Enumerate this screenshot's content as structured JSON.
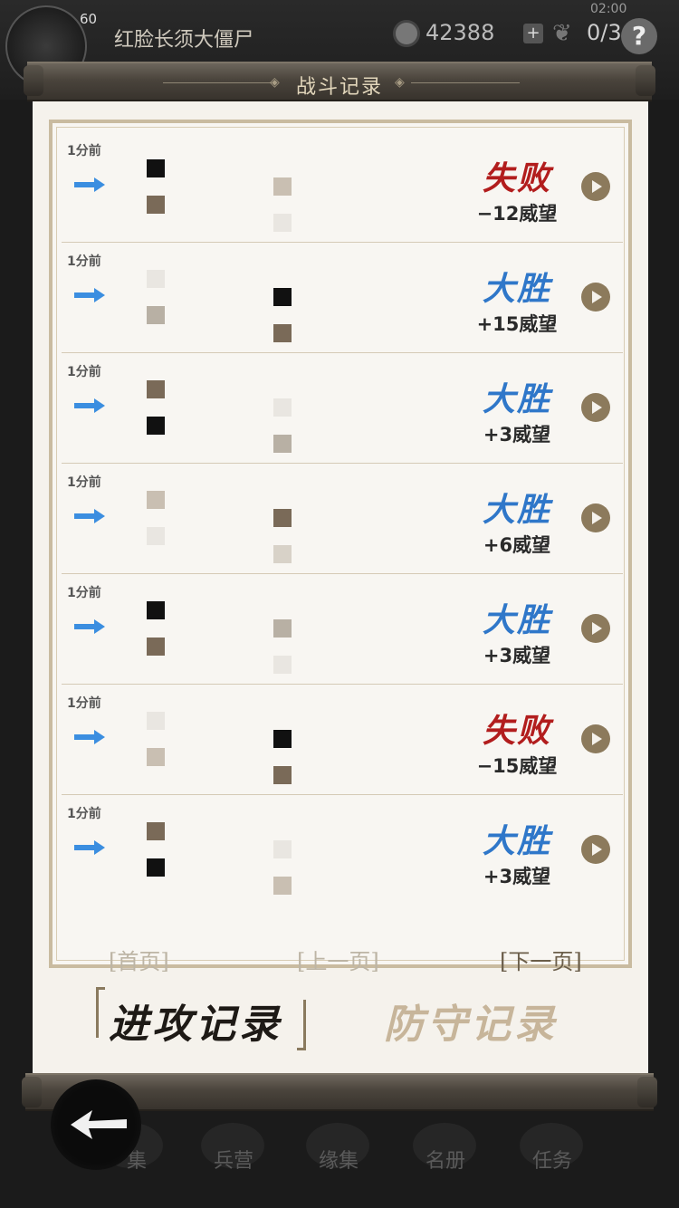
{
  "hud": {
    "level": "60",
    "player_name": "红脸长须大僵尸",
    "coins": "42388",
    "plus": "+",
    "count": "0/3",
    "clock": "02:00",
    "help": "?"
  },
  "panel": {
    "title": "战斗记录"
  },
  "records": [
    {
      "time": "1分前",
      "result": "失败",
      "result_type": "lose",
      "prestige": "−12威望"
    },
    {
      "time": "1分前",
      "result": "大胜",
      "result_type": "win",
      "prestige": "+15威望"
    },
    {
      "time": "1分前",
      "result": "大胜",
      "result_type": "win",
      "prestige": "+3威望"
    },
    {
      "time": "1分前",
      "result": "大胜",
      "result_type": "win",
      "prestige": "+6威望"
    },
    {
      "time": "1分前",
      "result": "大胜",
      "result_type": "win",
      "prestige": "+3威望"
    },
    {
      "time": "1分前",
      "result": "失败",
      "result_type": "lose",
      "prestige": "−15威望"
    },
    {
      "time": "1分前",
      "result": "大胜",
      "result_type": "win",
      "prestige": "+3威望"
    }
  ],
  "pagination": {
    "first": "[首页]",
    "prev": "[上一页]",
    "next": "[下一页]"
  },
  "tabs": {
    "attack": "进攻记录",
    "defense": "防守记录"
  },
  "bottom_nav": [
    "集",
    "兵营",
    "缘集",
    "名册",
    "任务"
  ],
  "colors": {
    "lose": "#b21d1d",
    "win": "#2f77c9",
    "paper": "#f5f2ec",
    "frame": "#c9bba0"
  }
}
